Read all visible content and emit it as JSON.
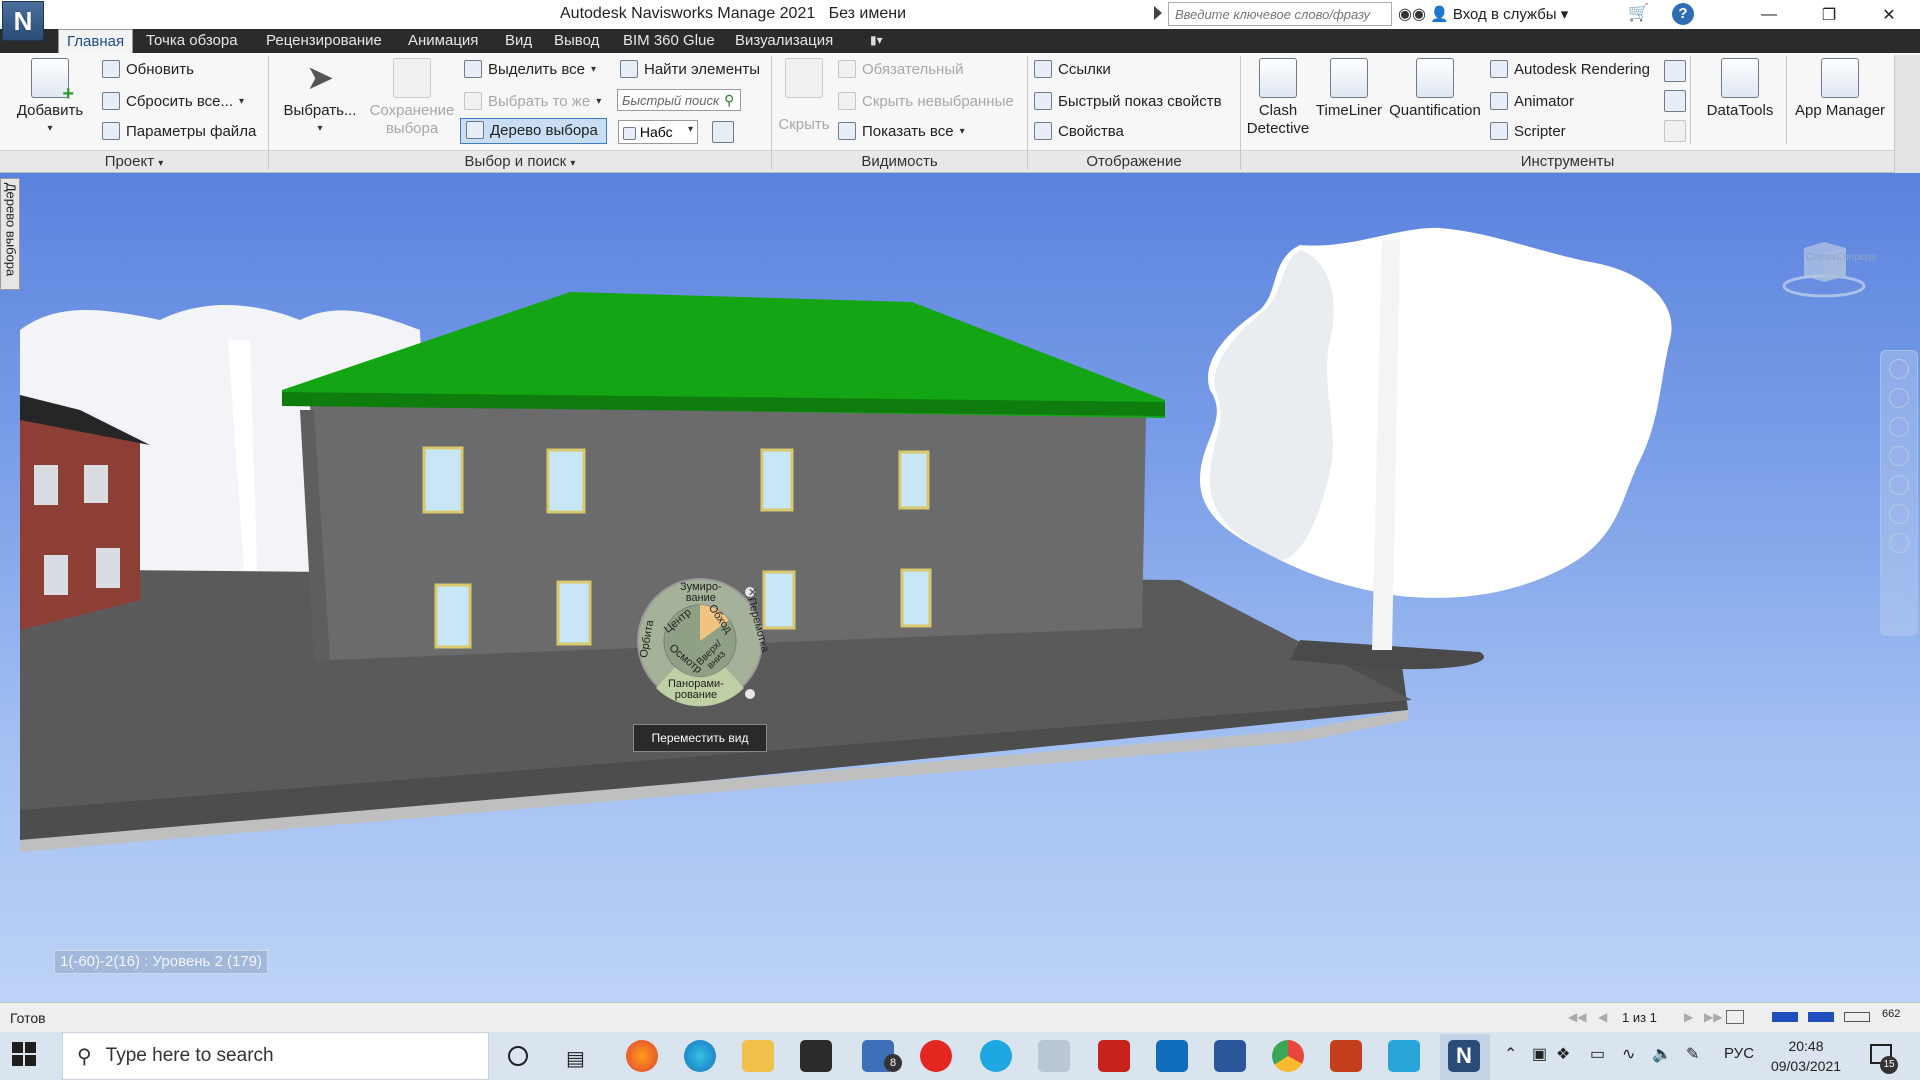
{
  "app": {
    "logo": "N",
    "title": "Autodesk Navisworks Manage 2021",
    "document": "Без имени",
    "search_placeholder": "Введите ключевое слово/фразу",
    "login": "Вход в службы"
  },
  "tabs": [
    {
      "label": "Главная",
      "active": true
    },
    {
      "label": "Точка обзора"
    },
    {
      "label": "Рецензирование"
    },
    {
      "label": "Анимация"
    },
    {
      "label": "Вид"
    },
    {
      "label": "Вывод"
    },
    {
      "label": "BIM 360 Glue"
    },
    {
      "label": "Визуализация"
    }
  ],
  "ribbon": {
    "project": {
      "label": "Проект",
      "add": "Добавить",
      "refresh": "Обновить",
      "reset_all": "Сбросить все...",
      "file_options": "Параметры файла"
    },
    "select": {
      "label": "Выбор и поиск",
      "select": "Выбрать...",
      "save_selection_1": "Сохранение",
      "save_selection_2": "выбора",
      "select_all": "Выделить все",
      "select_same": "Выбрать то же",
      "selection_tree": "Дерево выбора",
      "find_items": "Найти элементы",
      "quick_find_placeholder": "Быстрый поиск",
      "sets_combo": "Набс"
    },
    "visibility": {
      "label": "Видимость",
      "hide": "Скрыть",
      "required": "Обязательный",
      "hide_unselected": "Скрыть невыбранные",
      "show_all": "Показать все"
    },
    "display": {
      "label": "Отображение",
      "links": "Ссылки",
      "quick_properties": "Быстрый  показ свойств",
      "properties": "Свойства"
    },
    "tools": {
      "label": "Инструменты",
      "clash_1": "Clash",
      "clash_2": "Detective",
      "timeliner": "TimeLiner",
      "quantification": "Quantification",
      "rendering": "Autodesk Rendering",
      "animator": "Animator",
      "scripter": "Scripter",
      "datatools": "DataTools",
      "app_manager": "App Manager"
    }
  },
  "side_panel": "Дерево выбора",
  "viewcube": {
    "left": "Слева",
    "front": "Спереди"
  },
  "steering_wheel": {
    "zoom_1": "Зумиро-",
    "zoom_2": "вание",
    "rewind": "Перемотка",
    "pan_1": "Панорами-",
    "pan_2": "рование",
    "orbit": "Орбита",
    "center": "Центр",
    "walk": "Обход",
    "look": "Осмотр",
    "up_down_1": "Вверх/",
    "up_down_2": "вниз"
  },
  "tooltip": "Переместить вид",
  "level_label": "1(-60)-2(16) : Уровень 2 (179)",
  "status": {
    "text": "Готов",
    "page": "1 из 1",
    "memory": "662"
  },
  "taskbar": {
    "search": "Type here to search",
    "lang": "РУС",
    "time": "20:48",
    "date": "09/03/2021",
    "mail_badge": "8",
    "notif_badge": "15"
  },
  "colors": {
    "sky_top": "#5b83de",
    "roof": "#14a514",
    "wall": "#6b6b6b",
    "accent": "#3e7bc4"
  }
}
